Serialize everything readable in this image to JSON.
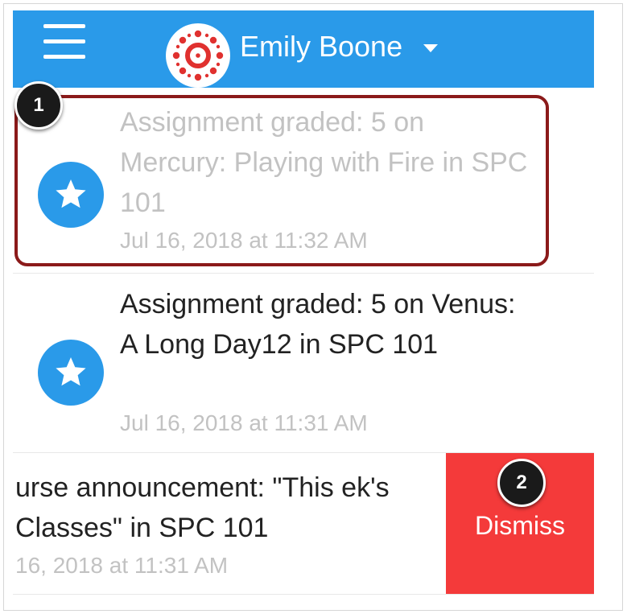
{
  "header": {
    "user_name": "Emily Boone",
    "menu_icon": "hamburger-icon",
    "logo_icon": "canvas-logo-icon",
    "dropdown_icon": "caret-down-icon",
    "background_color": "#2a9ae9"
  },
  "notifications": [
    {
      "title": "Assignment graded: 5 on Mercury: Playing with Fire in SPC 101",
      "date": "Jul 16, 2018 at 11:32 AM",
      "icon": "star-icon",
      "read": true
    },
    {
      "title": "Assignment graded: 5 on Venus: A Long Day12 in SPC 101",
      "date": "Jul 16, 2018 at 11:31 AM",
      "icon": "star-icon",
      "read": false
    }
  ],
  "swiped_notification": {
    "title": "urse announcement: \"This ek's Classes\" in SPC 101",
    "date": "16, 2018 at 11:31 AM",
    "dismiss_label": "Dismiss",
    "dismiss_color": "#f43a3a"
  },
  "callouts": [
    {
      "number": "1"
    },
    {
      "number": "2"
    }
  ],
  "highlight_color": "#8b1a1a"
}
